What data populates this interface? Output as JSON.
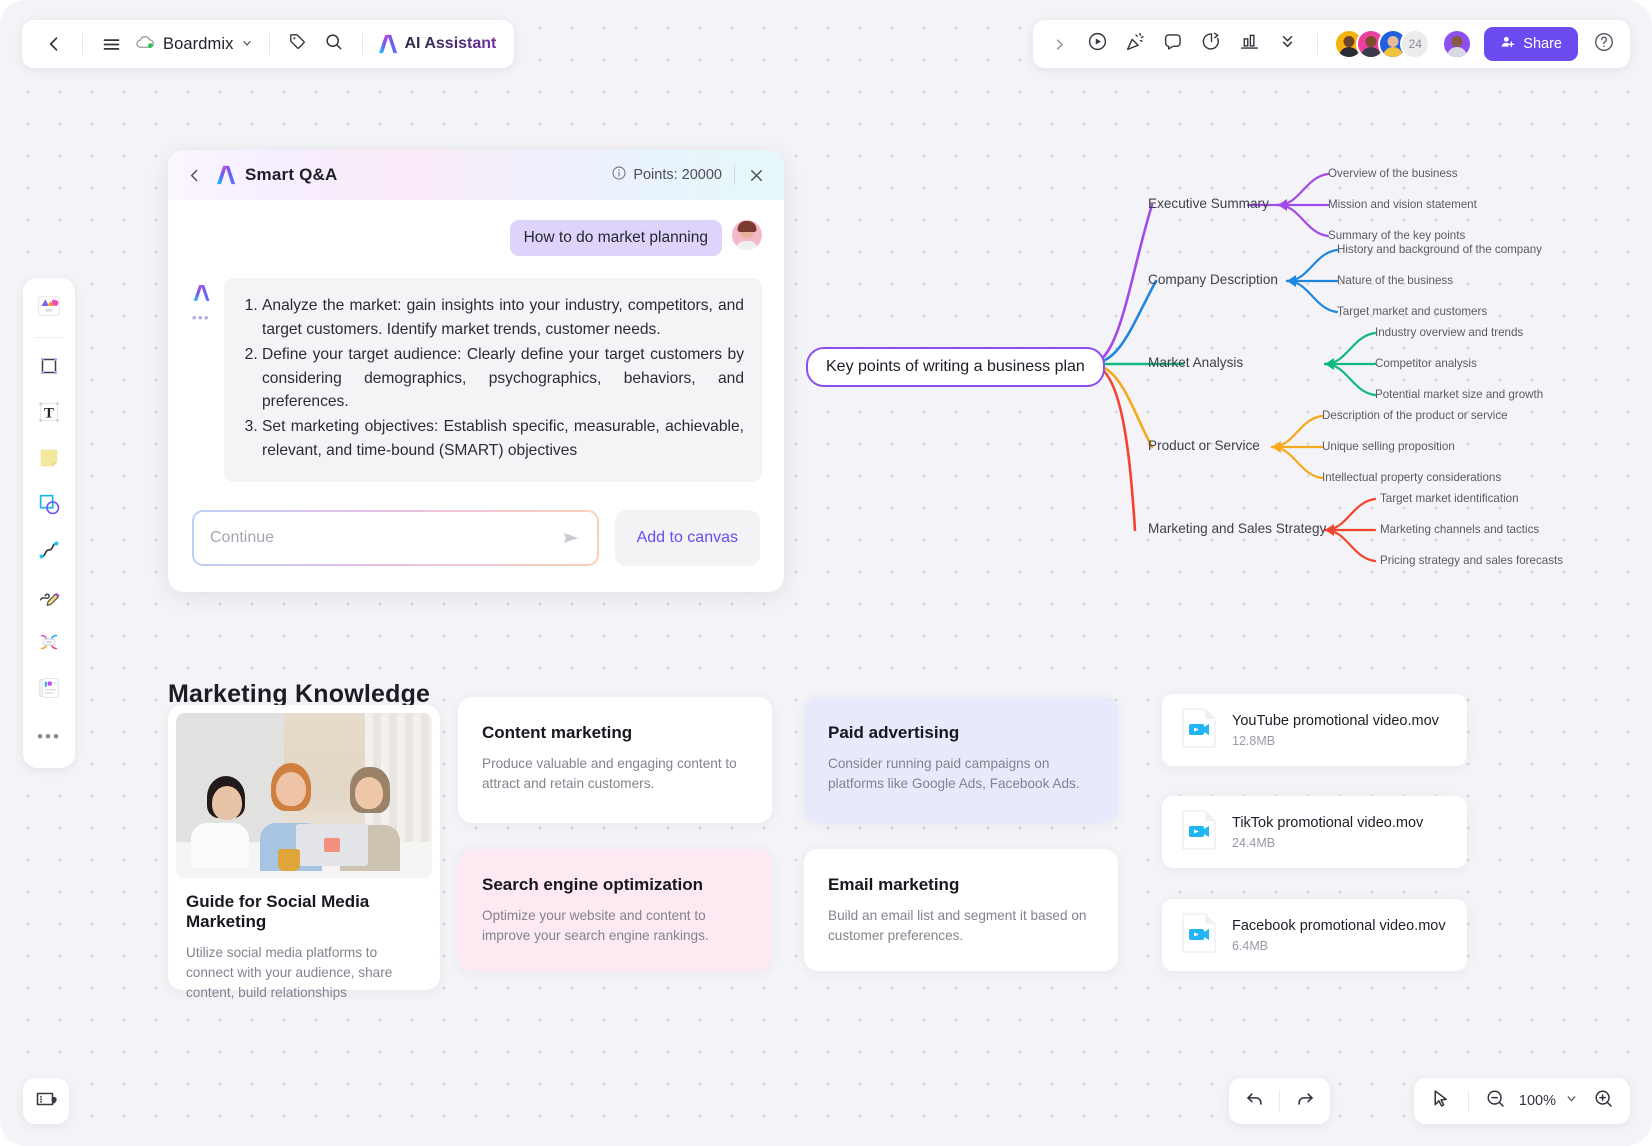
{
  "topbar_left": {
    "back_icon": "chevron-left-icon",
    "menu_icon": "hamburger-menu-icon",
    "doc_name": "Boardmix",
    "doc_chevron": "chevron-down-icon",
    "tag_icon": "tag-icon",
    "search_icon": "search-icon",
    "ai_label": "AI Assistant"
  },
  "topbar_right": {
    "expand_icon": "chevron-right-icon",
    "present_icon": "play-circle-icon",
    "celebrate_icon": "party-popper-icon",
    "comment_icon": "comment-bubble-icon",
    "timer_icon": "timer-icon",
    "chart_icon": "bar-chart-icon",
    "more_icon": "double-chevron-down-icon",
    "collaborator_count": "24",
    "share_label": "Share",
    "share_icon": "add-user-icon",
    "help_icon": "help-circle-icon",
    "share_color": "#6b4bf0"
  },
  "left_tools": [
    {
      "name": "templates-tool",
      "icon": "templates-icon"
    },
    {
      "name": "frame-tool",
      "icon": "frame-icon"
    },
    {
      "name": "text-tool",
      "icon": "text-T-icon"
    },
    {
      "name": "sticky-note-tool",
      "icon": "sticky-note-icon"
    },
    {
      "name": "shapes-tool",
      "icon": "shapes-icon"
    },
    {
      "name": "connector-tool",
      "icon": "curve-line-icon"
    },
    {
      "name": "pen-tool",
      "icon": "pencil-scribble-icon"
    },
    {
      "name": "mindmap-tool",
      "icon": "mindmap-icon"
    },
    {
      "name": "document-tool",
      "icon": "document-card-icon"
    },
    {
      "name": "more-tools",
      "icon": "three-dots-icon"
    }
  ],
  "bottom_left": {
    "icon": "minimap-icon"
  },
  "qa_panel": {
    "back_icon": "chevron-left-icon",
    "logo_icon": "ai-logo-icon",
    "title": "Smart Q&A",
    "info_icon": "info-circle-icon",
    "points_label": "Points: 20000",
    "close_icon": "close-x-icon",
    "user_message": "How to do market planning",
    "ai_answer_items": [
      "Analyze the market: gain insights into your industry, competitors, and target customers. Identify market trends, customer needs.",
      "Define your target audience: Clearly define your target customers by considering demographics, psychographics, behaviors, and preferences.",
      "Set marketing objectives: Establish specific, measurable, achievable, relevant, and time-bound (SMART) objectives"
    ],
    "input_value": "",
    "input_placeholder": "Continue",
    "send_icon": "send-arrow-icon",
    "add_to_canvas_label": "Add to canvas",
    "accent_color": "#6b4bf0"
  },
  "marketing": {
    "section_title": "Marketing Knowledge",
    "cards": [
      {
        "id": "guide",
        "title": "Guide for Social Media Marketing",
        "desc": "Utilize social media platforms to connect with your audience, share content, build relationships",
        "bg": "#ffffff",
        "has_image": true
      },
      {
        "id": "content",
        "title": "Content marketing",
        "desc": " Produce valuable and engaging content to attract and retain customers.",
        "bg": "#ffffff",
        "has_image": false
      },
      {
        "id": "seo",
        "title": "Search engine optimization",
        "desc": "Optimize your website and content to improve your search engine rankings.",
        "bg": "#fde9f1",
        "has_image": false
      },
      {
        "id": "paid",
        "title": "Paid advertising",
        "desc": "Consider running paid campaigns on platforms like Google Ads, Facebook Ads.",
        "bg": "#e7eafb",
        "has_image": false
      },
      {
        "id": "email",
        "title": "Email marketing",
        "desc": " Build an email list and segment it based on customer preferences.",
        "bg": "#ffffff",
        "has_image": false
      }
    ]
  },
  "files": [
    {
      "name": "YouTube promotional video.mov",
      "size": "12.8MB",
      "icon": "video-file-icon"
    },
    {
      "name": "TikTok promotional video.mov",
      "size": "24.4MB",
      "icon": "video-file-icon"
    },
    {
      "name": "Facebook promotional video.mov",
      "size": "6.4MB",
      "icon": "video-file-icon"
    }
  ],
  "mindmap": {
    "root": "Key points of writing a business plan",
    "root_color": "#8b4ff0",
    "branches": [
      {
        "label": "Executive Summary",
        "color": "#a24ae8",
        "leaves": [
          "Overview of the business",
          "Mission and vision statement",
          "Summary of the key points"
        ]
      },
      {
        "label": "Company Description",
        "color": "#1f86e0",
        "leaves": [
          "History and background of the company",
          "Nature of the business",
          "Target market and customers"
        ]
      },
      {
        "label": "Market Analysis",
        "color": "#0fb97f",
        "leaves": [
          "Industry overview and trends",
          "Competitor analysis",
          "Potential market size and growth"
        ]
      },
      {
        "label": "Product or Service",
        "color": "#f7a81b",
        "leaves": [
          "Description of the product or service",
          "Unique selling proposition",
          "Intellectual property considerations"
        ]
      },
      {
        "label": "Marketing and Sales Strategy",
        "color": "#f4442e",
        "leaves": [
          "Target market identification",
          "Marketing channels and tactics",
          "Pricing strategy and sales forecasts"
        ]
      }
    ]
  },
  "bottom_right": {
    "undo_icon": "undo-arrow-icon",
    "redo_icon": "redo-arrow-icon",
    "cursor_icon": "cursor-pointer-icon",
    "zoom_out_icon": "zoom-out-icon",
    "zoom_level": "100%",
    "zoom_chevron": "chevron-down-icon",
    "zoom_in_icon": "zoom-in-icon"
  }
}
